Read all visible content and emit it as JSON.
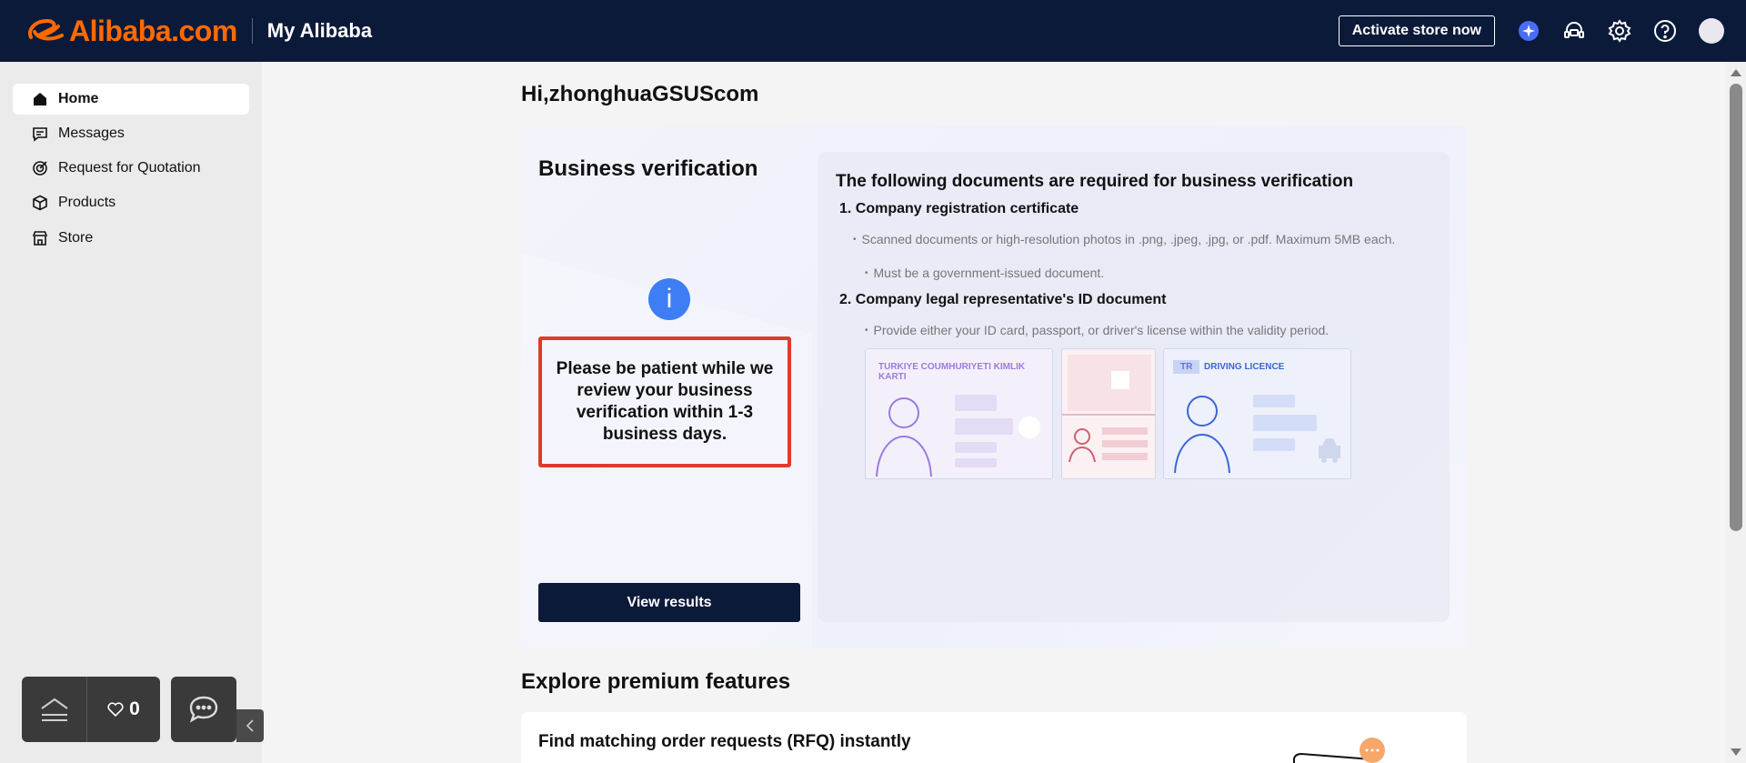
{
  "header": {
    "logo_text": "Alibaba.com",
    "section_title": "My Alibaba",
    "activate_label": "Activate store now",
    "icons": [
      "ai-assistant-icon",
      "support-headset-icon",
      "settings-gear-icon",
      "help-question-icon",
      "avatar"
    ]
  },
  "sidebar": {
    "items": [
      {
        "label": "Home",
        "icon": "home-icon",
        "active": true
      },
      {
        "label": "Messages",
        "icon": "messages-icon"
      },
      {
        "label": "Request for Quotation",
        "icon": "rfq-target-icon"
      },
      {
        "label": "Products",
        "icon": "box-icon"
      },
      {
        "label": "Store",
        "icon": "store-icon"
      }
    ]
  },
  "widgets": {
    "favorites_count": "0"
  },
  "main": {
    "greeting": "Hi,zhonghuaGSUScom",
    "verification": {
      "title": "Business verification",
      "info_glyph": "i",
      "patience_text": "Please be patient while we review your business verification within 1-3 business days.",
      "view_results_label": "View results",
      "docs_title": "The following documents are required for business verification",
      "doc1_heading": "1.  Company registration certificate",
      "doc1_bullet1": "Scanned documents or high-resolution photos in .png, .jpeg, .jpg, or .pdf. Maximum 5MB each.",
      "doc1_bullet2": "Must be a government-issued document.",
      "doc2_heading": "2.  Company legal representative's ID document",
      "doc2_bullet1": "Provide either your ID card, passport, or driver's license within the validity period.",
      "id_card_label": "TURKIYE COUMHURIYETI KIMLIK KARTI",
      "license_code": "TR",
      "license_label": "DRIVING LICENCE"
    },
    "premium_title": "Explore premium features",
    "rfq_title": "Find matching order requests (RFQ) instantly"
  },
  "colors": {
    "header_bg": "#0c1a3a",
    "brand_orange": "#ff6a00",
    "highlight_red": "#e03a2a",
    "info_blue": "#3d7ef5"
  }
}
